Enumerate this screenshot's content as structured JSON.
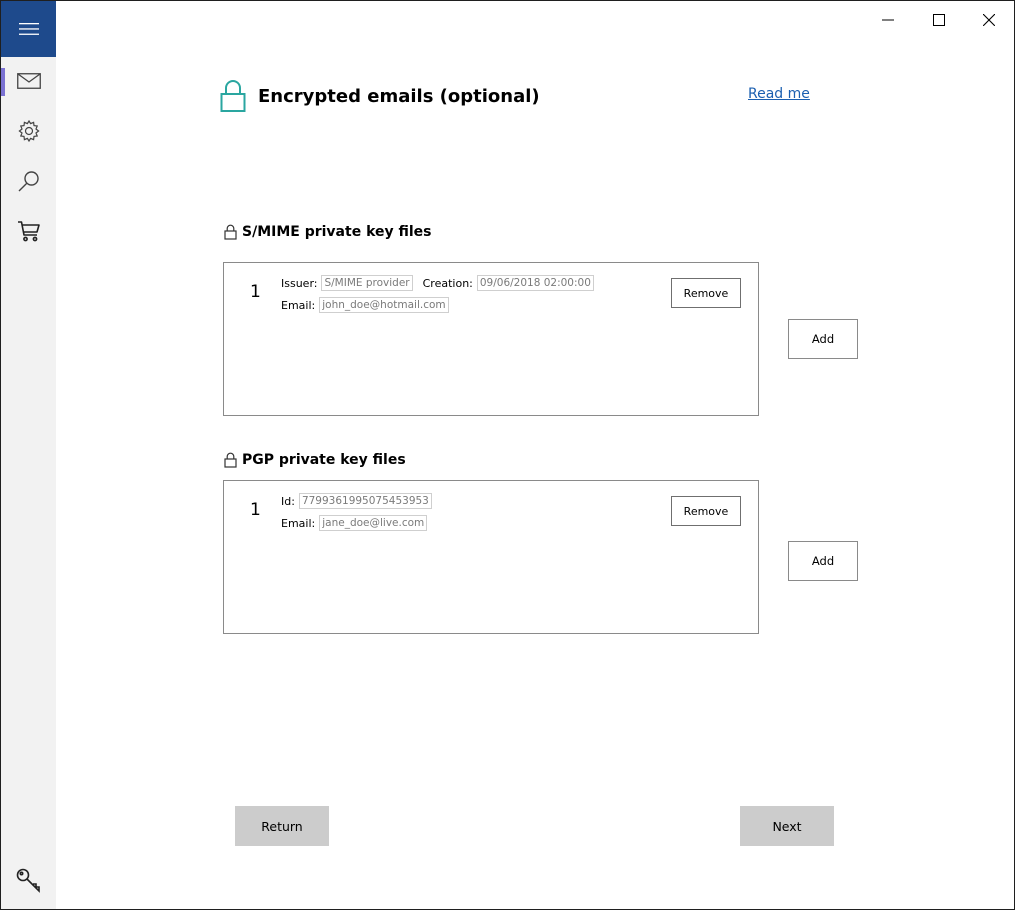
{
  "nav": {
    "items": [
      {
        "icon": "mail-icon",
        "active": true
      },
      {
        "icon": "gear-icon",
        "active": false
      },
      {
        "icon": "search-icon",
        "active": false
      },
      {
        "icon": "cart-icon",
        "active": false
      }
    ],
    "accent_color": "#1e4a8c",
    "active_indicator_color": "#7b72d2"
  },
  "header": {
    "title": "Encrypted emails (optional)",
    "read_me_label": "Read me",
    "icon": "lock-icon",
    "icon_color": "#2aa6a0"
  },
  "smime": {
    "title": "S/MIME private key files",
    "entries": [
      {
        "number": "1",
        "issuer_label": "Issuer:",
        "issuer": "S/MIME provider",
        "creation_label": "Creation:",
        "creation": "09/06/2018 02:00:00",
        "email_label": "Email:",
        "email": "john_doe@hotmail.com",
        "remove_label": "Remove"
      }
    ],
    "add_label": "Add"
  },
  "pgp": {
    "title": "PGP private key files",
    "entries": [
      {
        "number": "1",
        "id_label": "Id:",
        "id": "7799361995075453953",
        "email_label": "Email:",
        "email": "jane_doe@live.com",
        "remove_label": "Remove"
      }
    ],
    "add_label": "Add"
  },
  "footer": {
    "return_label": "Return",
    "next_label": "Next"
  }
}
